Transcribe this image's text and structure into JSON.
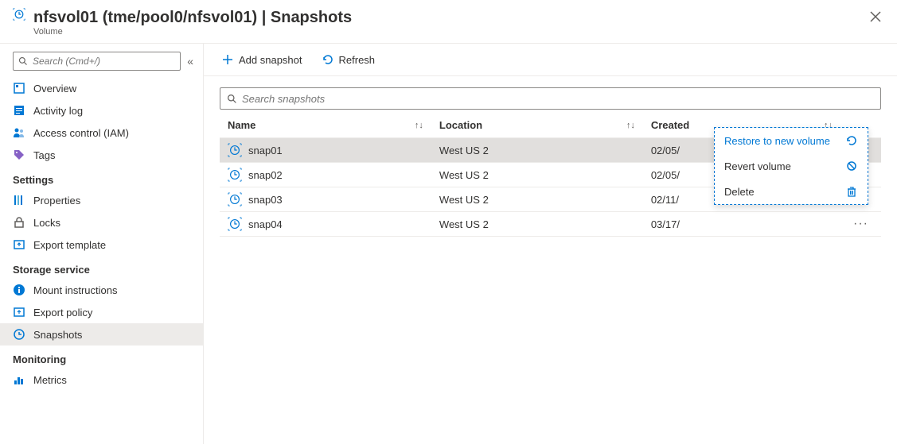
{
  "header": {
    "title": "nfsvol01 (tme/pool0/nfsvol01) | Snapshots",
    "subtitle": "Volume"
  },
  "sidebar": {
    "search_placeholder": "Search (Cmd+/)",
    "items_top": [
      {
        "label": "Overview",
        "icon": "overview"
      },
      {
        "label": "Activity log",
        "icon": "activity-log"
      },
      {
        "label": "Access control (IAM)",
        "icon": "access-control"
      },
      {
        "label": "Tags",
        "icon": "tags"
      }
    ],
    "section_settings": "Settings",
    "items_settings": [
      {
        "label": "Properties",
        "icon": "properties"
      },
      {
        "label": "Locks",
        "icon": "locks"
      },
      {
        "label": "Export template",
        "icon": "export-template"
      }
    ],
    "section_storage": "Storage service",
    "items_storage": [
      {
        "label": "Mount instructions",
        "icon": "mount"
      },
      {
        "label": "Export policy",
        "icon": "export-policy"
      },
      {
        "label": "Snapshots",
        "icon": "snapshots",
        "active": true
      }
    ],
    "section_monitoring": "Monitoring",
    "items_monitoring": [
      {
        "label": "Metrics",
        "icon": "metrics"
      }
    ]
  },
  "toolbar": {
    "add_label": "Add snapshot",
    "refresh_label": "Refresh"
  },
  "snapshots": {
    "search_placeholder": "Search snapshots",
    "columns": {
      "name": "Name",
      "location": "Location",
      "created": "Created"
    },
    "rows": [
      {
        "name": "snap01",
        "location": "West US 2",
        "created": "02/05/",
        "selected": true
      },
      {
        "name": "snap02",
        "location": "West US 2",
        "created": "02/05/"
      },
      {
        "name": "snap03",
        "location": "West US 2",
        "created": "02/11/"
      },
      {
        "name": "snap04",
        "location": "West US 2",
        "created": "03/17/"
      }
    ]
  },
  "context_menu": {
    "restore": "Restore to new volume",
    "revert": "Revert volume",
    "delete": "Delete"
  },
  "icons": {
    "sort": "↑↓"
  }
}
